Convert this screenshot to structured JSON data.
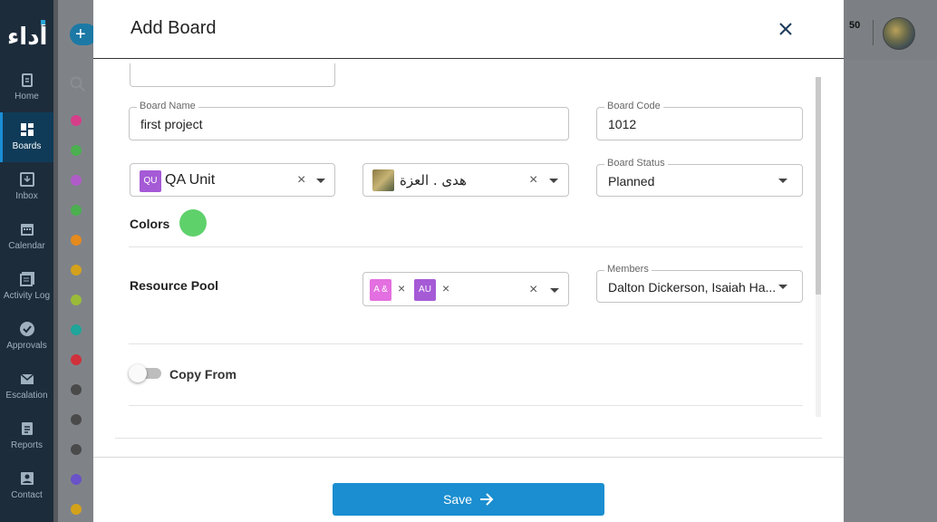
{
  "app": {
    "logo_text": "أداء",
    "notification_count": "50"
  },
  "sidebar": {
    "items": [
      {
        "label": "Home",
        "icon": "clipboard-icon"
      },
      {
        "label": "Boards",
        "icon": "grid-icon",
        "active": true
      },
      {
        "label": "Inbox",
        "icon": "inbox-icon"
      },
      {
        "label": "Calendar",
        "icon": "calendar-icon"
      },
      {
        "label": "Activity Log",
        "icon": "list-icon"
      },
      {
        "label": "Approvals",
        "icon": "check-circle-icon"
      },
      {
        "label": "Escalation",
        "icon": "mail-icon"
      },
      {
        "label": "Reports",
        "icon": "report-icon"
      },
      {
        "label": "Contact",
        "icon": "contact-icon"
      }
    ]
  },
  "background_dots": [
    "#d63e8a",
    "#4caf50",
    "#b05cc8",
    "#4caf50",
    "#e58a1c",
    "#d4a21a",
    "#9aba3a",
    "#1fa59a",
    "#d0313c",
    "#4a4a4a",
    "#4a4a4a",
    "#4a4a4a",
    "#6a52c8",
    "#d4a21a"
  ],
  "modal": {
    "title": "Add Board",
    "board_name": {
      "label": "Board Name",
      "value": "first project"
    },
    "board_code": {
      "label": "Board Code",
      "value": "1012"
    },
    "unit": {
      "chip": "QU",
      "value": "QA Unit",
      "chip_color": "#a55ad6"
    },
    "owner": {
      "value": "هدى . العزة"
    },
    "board_status": {
      "label": "Board Status",
      "value": "Planned"
    },
    "colors_label": "Colors",
    "selected_color": "#5fd16b",
    "resource_pool": {
      "label": "Resource Pool",
      "chips": [
        {
          "text": "A &",
          "color": "#e36fe0"
        },
        {
          "text": "AU",
          "color": "#a55ad6"
        }
      ],
      "chip_remove": "×"
    },
    "members": {
      "label": "Members",
      "value": "Dalton Dickerson, Isaiah Ha..."
    },
    "copy_from": {
      "label": "Copy From",
      "enabled": false
    },
    "save_label": "Save"
  }
}
